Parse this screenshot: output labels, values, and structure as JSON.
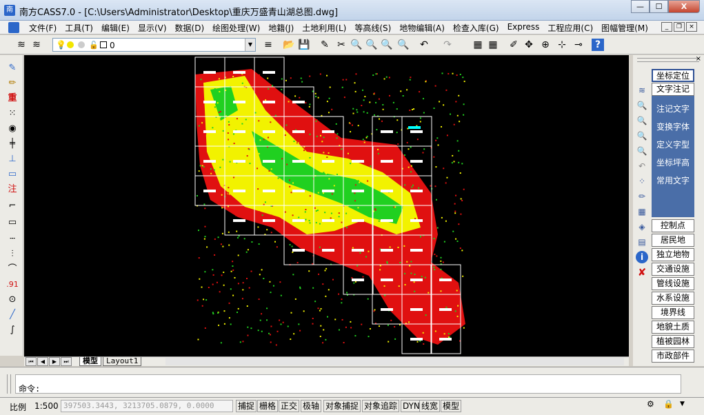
{
  "window": {
    "title": "南方CASS7.0 - [C:\\Users\\Administrator\\Desktop\\重庆万盛青山湖总图.dwg]",
    "minimize": "—",
    "maximize": "☐",
    "close": "X"
  },
  "menu": {
    "items": [
      "文件(F)",
      "工具(T)",
      "编辑(E)",
      "显示(V)",
      "数据(D)",
      "绘图处理(W)",
      "地籍(J)",
      "土地利用(L)",
      "等高线(S)",
      "地物编辑(A)",
      "检查入库(G)",
      "Express",
      "工程应用(C)",
      "图幅管理(M)"
    ],
    "mdi_min": "_",
    "mdi_restore": "❐",
    "mdi_close": "×"
  },
  "toolbar": {
    "layer_value": "0"
  },
  "drawing": {
    "background": "#000000",
    "colors": {
      "red": "#e01010",
      "yellow": "#f2f200",
      "green": "#20d020",
      "grid": "#ffffff",
      "cyan": "#00ffff"
    }
  },
  "layout_tabs": {
    "tabs": [
      "模型",
      "Layout1"
    ],
    "active": "模型"
  },
  "right_panel": {
    "buttons_top": [
      "坐标定位",
      "文字注记"
    ],
    "blue_items": [
      "注记文字",
      "变换字体",
      "定义字型",
      "坐标坪高",
      "常用文字"
    ],
    "buttons_bottom": [
      "控制点",
      "居民地",
      "独立地物",
      "交通设施",
      "管线设施",
      "水系设施",
      "境界线",
      "地貌土质",
      "植被园林",
      "市政部件"
    ]
  },
  "command": {
    "prompt": "命令:"
  },
  "status": {
    "scale_label": "比例",
    "scale_value": "1:500",
    "coords": "397503.3443, 3213705.0879, 0.0000",
    "toggles": [
      "捕捉",
      "栅格",
      "正交",
      "极轴",
      "对象捕捉",
      "对象追踪",
      "DYN",
      "线宽",
      "模型"
    ]
  }
}
